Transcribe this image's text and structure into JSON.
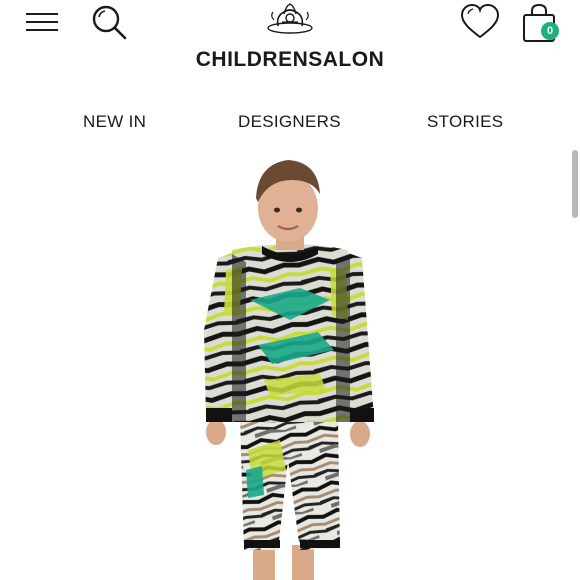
{
  "header": {
    "brand": "CHILDRENSALON",
    "bag_count": "0",
    "icons": {
      "menu": "hamburger-menu-icon",
      "search": "search-icon",
      "logo": "brand-crest-logo",
      "wishlist": "heart-icon",
      "bag": "shopping-bag-icon"
    },
    "accent_color": "#1fb07a"
  },
  "nav": {
    "items": [
      {
        "label": "NEW IN"
      },
      {
        "label": "DESIGNERS"
      },
      {
        "label": "STORIES"
      }
    ]
  },
  "hero": {
    "image": "boy-in-multicolor-zigzag-print-hoodie-and-shorts"
  }
}
